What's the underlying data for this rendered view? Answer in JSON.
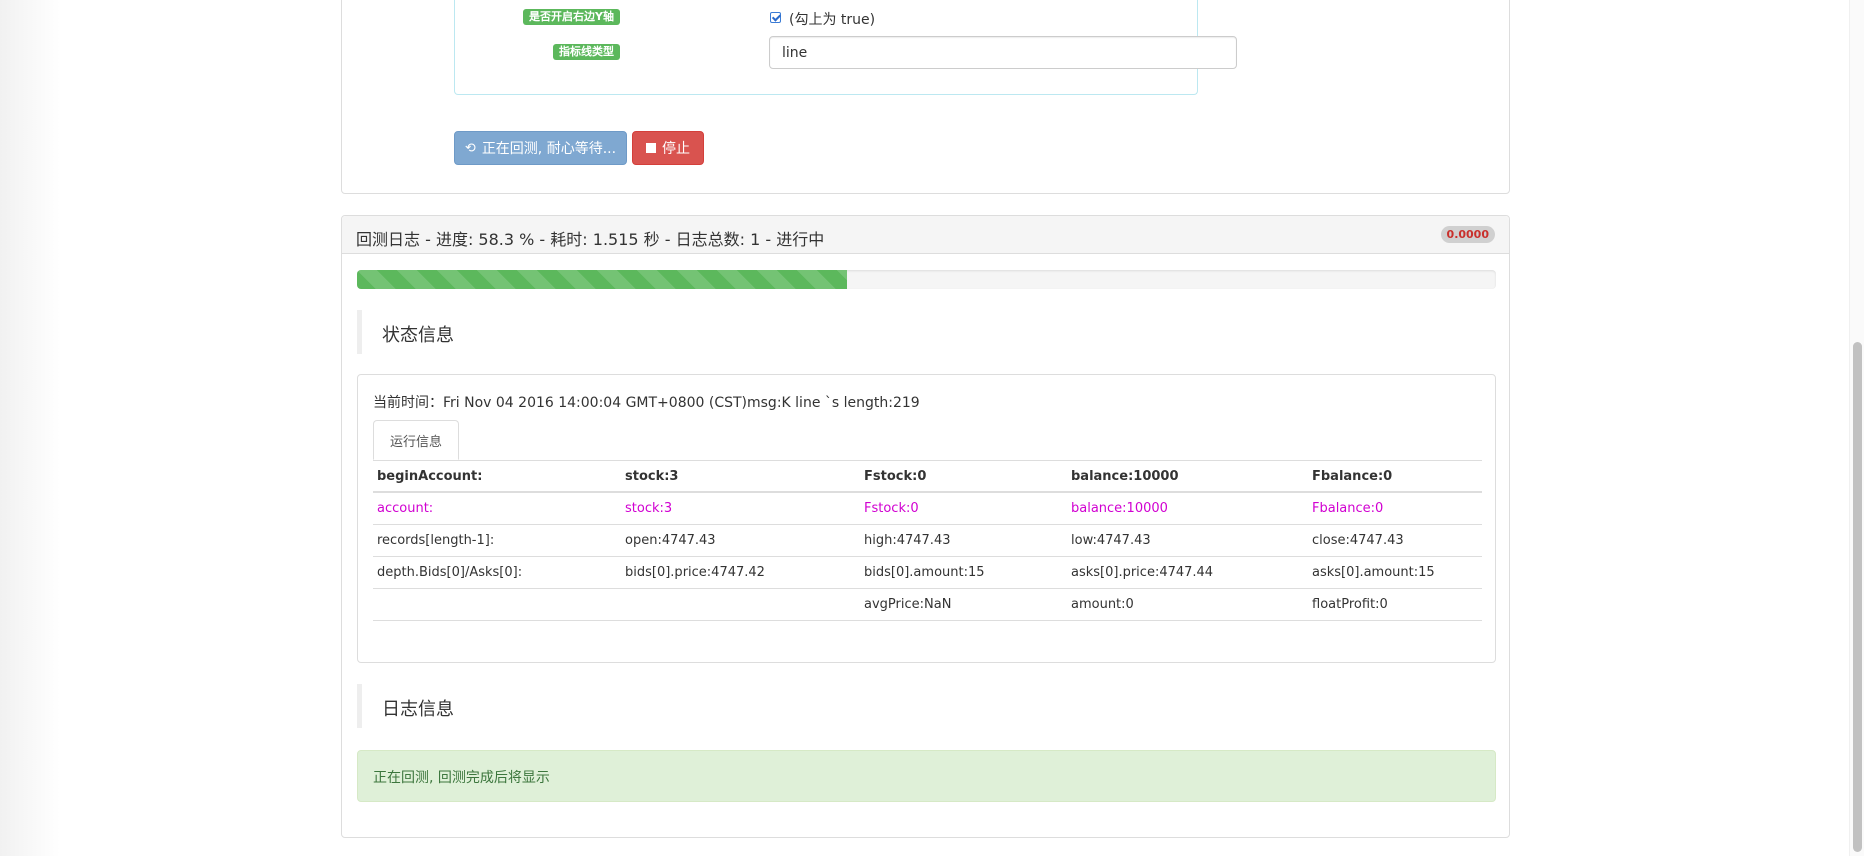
{
  "config": {
    "right_yaxis_label": "是否开启右边Y轴",
    "right_yaxis_check_text": "(勾上为 true)",
    "right_yaxis_checked": true,
    "indicator_type_label": "指标线类型",
    "indicator_type_value": "line"
  },
  "buttons": {
    "running_label": "正在回测, 耐心等待...",
    "stop_label": "停止"
  },
  "log": {
    "title": "回测日志 - 进度: 58.3 % - 耗时: 1.515 秒 - 日志总数: 1 - 进行中",
    "badge": "0.0000",
    "progress_percent": 43
  },
  "status": {
    "section_title": "状态信息",
    "current_time": "当前时间：Fri Nov 04 2016 14:00:04 GMT+0800 (CST)msg:K line `s length:219",
    "tab_label": "运行信息",
    "table": {
      "header": [
        "beginAccount:",
        "stock:3",
        "Fstock:0",
        "balance:10000",
        "Fbalance:0"
      ],
      "rows": [
        [
          "account:",
          "stock:3",
          "Fstock:0",
          "balance:10000",
          "Fbalance:0"
        ],
        [
          "records[length-1]:",
          "open:4747.43",
          "high:4747.43",
          "low:4747.43",
          "close:4747.43"
        ],
        [
          "depth.Bids[0]/Asks[0]:",
          "bids[0].price:4747.42",
          "bids[0].amount:15",
          "asks[0].price:4747.44",
          "asks[0].amount:15"
        ],
        [
          "",
          "",
          "avgPrice:NaN",
          "amount:0",
          "floatProfit:0"
        ]
      ]
    },
    "account_row_color": "#d100d1"
  },
  "logs": {
    "section_title": "日志信息",
    "notice": "正在回测, 回测完成后将显示"
  }
}
